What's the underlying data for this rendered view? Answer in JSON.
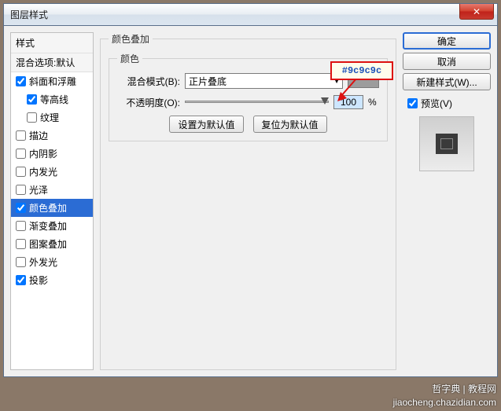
{
  "window": {
    "title": "图层样式"
  },
  "styles": {
    "header": "样式",
    "blend_defaults": "混合选项:默认",
    "items": [
      {
        "label": "斜面和浮雕",
        "checked": true
      },
      {
        "label": "等高线",
        "checked": true,
        "indent": true
      },
      {
        "label": "纹理",
        "checked": false,
        "indent": true
      },
      {
        "label": "描边",
        "checked": false
      },
      {
        "label": "内阴影",
        "checked": false
      },
      {
        "label": "内发光",
        "checked": false
      },
      {
        "label": "光泽",
        "checked": false
      },
      {
        "label": "颜色叠加",
        "checked": true,
        "selected": true
      },
      {
        "label": "渐变叠加",
        "checked": false
      },
      {
        "label": "图案叠加",
        "checked": false
      },
      {
        "label": "外发光",
        "checked": false
      },
      {
        "label": "投影",
        "checked": true
      }
    ]
  },
  "panel": {
    "title": "颜色叠加",
    "group": "颜色",
    "blend_label": "混合模式(B):",
    "blend_value": "正片叠底",
    "opacity_label": "不透明度(O):",
    "opacity_value": "100",
    "opacity_unit": "%",
    "btn_setdef": "设置为默认值",
    "btn_resetdef": "复位为默认值"
  },
  "buttons": {
    "ok": "确定",
    "cancel": "取消",
    "newstyle": "新建样式(W)...",
    "preview": "预览(V)"
  },
  "annotation": {
    "color": "#9c9c9c"
  },
  "watermark": {
    "line1": "哲字典 | 教程网",
    "line2": "jiaocheng.chazidian.com"
  }
}
